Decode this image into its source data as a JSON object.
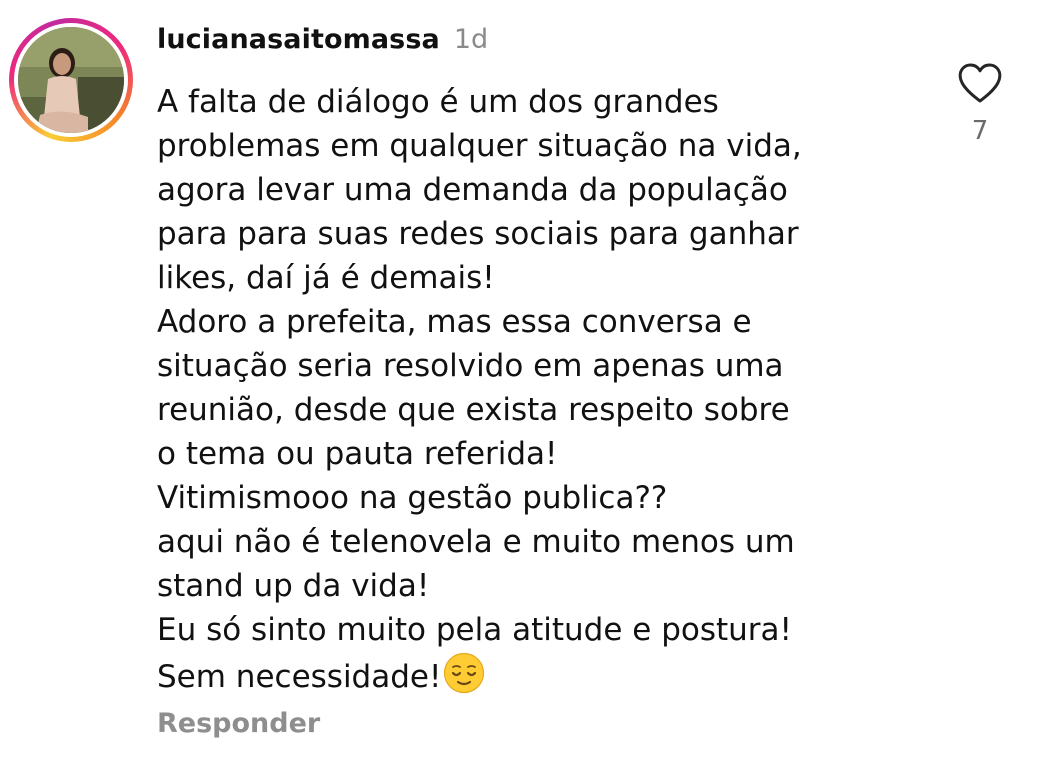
{
  "comment": {
    "username": "lucianasaitomassa",
    "timestamp": "1d",
    "lines": [
      "A falta de diálogo é um dos grandes",
      "problemas em qualquer situação na vida,",
      "agora levar uma demanda da população",
      "para para suas redes sociais para ganhar",
      "likes, daí já é demais!",
      "Adoro a prefeita, mas essa conversa e",
      "situação seria resolvido em apenas uma",
      "reunião, desde que exista respeito sobre",
      "o tema ou pauta referida!",
      "Vitimismooo na gestão publica??",
      "aqui não é telenovela e muito menos um",
      "stand up da vida!",
      "Eu só sinto muito pela atitude e postura!",
      "Sem necessidade!"
    ],
    "emoji": "relieved-face-emoji",
    "like_count": "7",
    "like_icon": "heart-outline-icon",
    "reply_label": "Responder"
  },
  "colors": {
    "text": "#111111",
    "muted": "#8e8e8e",
    "story_ring": [
      "#f9ce34",
      "#ee2a7b",
      "#c22a9f",
      "#f58529"
    ]
  }
}
